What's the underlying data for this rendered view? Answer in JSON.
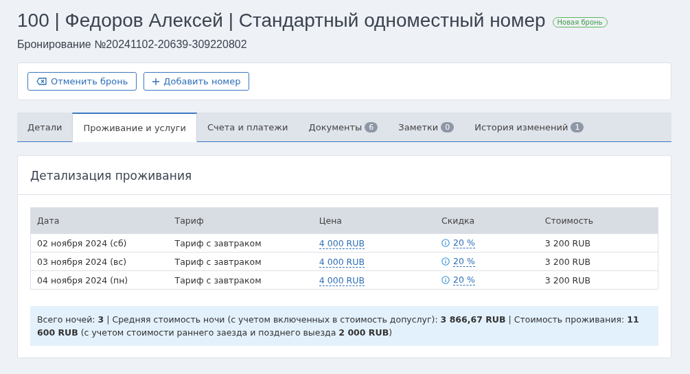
{
  "header": {
    "title": "100 | Федоров Алексей | Стандартный одноместный номер",
    "status_badge": "Новая бронь",
    "subtitle": "Бронирование №20241102-20639-309220802"
  },
  "actions": [
    {
      "kind": "cancel",
      "label": "Отменить бронь"
    },
    {
      "kind": "add",
      "label": "Добавить номер"
    }
  ],
  "tabs": [
    {
      "label": "Детали",
      "selected": false
    },
    {
      "label": "Проживание и услуги",
      "selected": true
    },
    {
      "label": "Счета и платежи",
      "selected": false
    },
    {
      "label": "Документы",
      "count": "6",
      "selected": false
    },
    {
      "label": "Заметки",
      "count": "0",
      "selected": false
    },
    {
      "label": "История изменений",
      "count": "1",
      "selected": false
    }
  ],
  "panel": {
    "title": "Детализация проживания",
    "table": {
      "columns": [
        "Дата",
        "Тариф",
        "Цена",
        "Скидка",
        "Стоимость"
      ],
      "rows": [
        {
          "date": "02 ноября 2024 (сб)",
          "tariff": "Тариф с завтраком",
          "price": "4 000 RUB",
          "discount": "20 %",
          "cost": "3 200 RUB"
        },
        {
          "date": "03 ноября 2024 (вс)",
          "tariff": "Тариф с завтраком",
          "price": "4 000 RUB",
          "discount": "20 %",
          "cost": "3 200 RUB"
        },
        {
          "date": "04 ноября 2024 (пн)",
          "tariff": "Тариф с завтраком",
          "price": "4 000 RUB",
          "discount": "20 %",
          "cost": "3 200 RUB"
        }
      ]
    },
    "summary": "Всего ночей: **3** | Средняя стоимость ночи (с учетом включенных в стоимость допуслуг): **3 866,67 RUB** | Стоимость проживания: **11 600 RUB** (с учетом стоимости раннего заезда и позднего выезда **2 000 RUB**)"
  }
}
